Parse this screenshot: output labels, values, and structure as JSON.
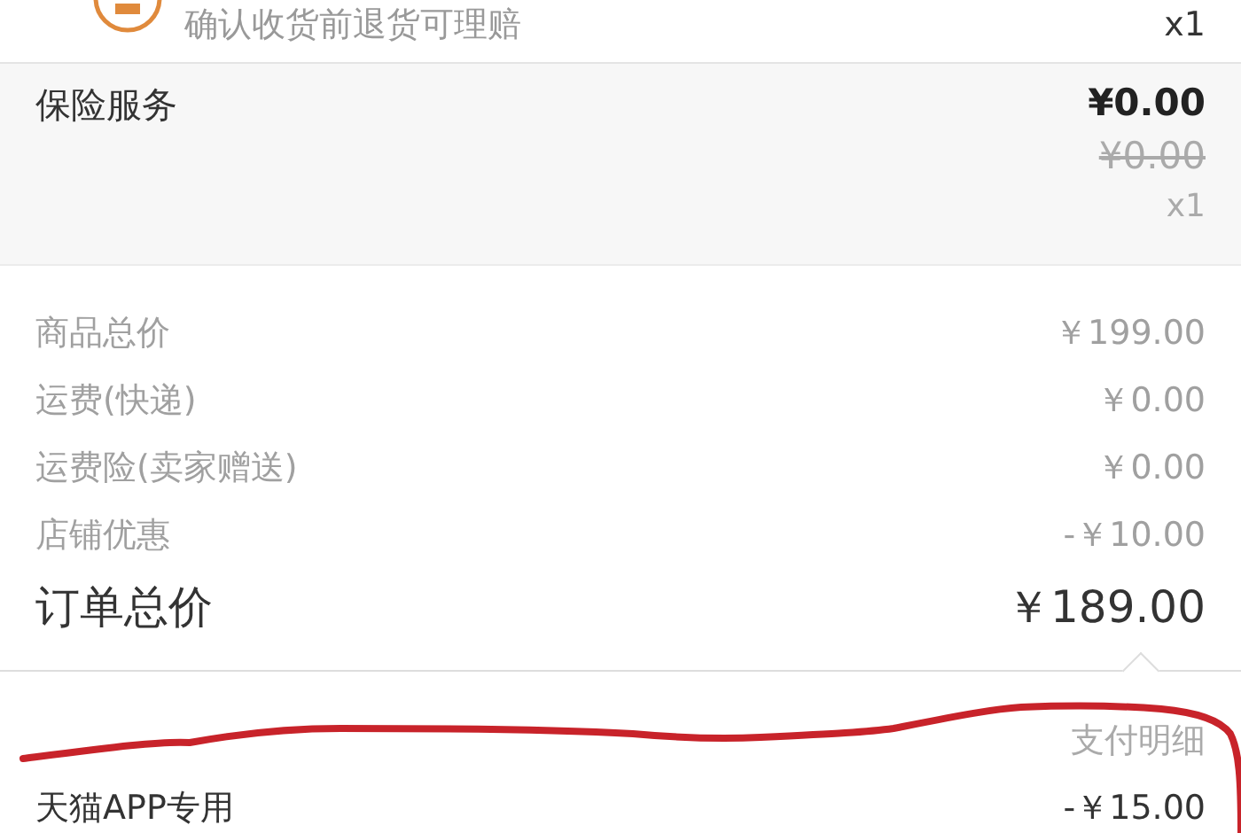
{
  "service_item": {
    "note": "确认收货前退货可理赔",
    "quantity": "x1"
  },
  "insurance": {
    "label": "保险服务",
    "price": "¥0.00",
    "original_price": "¥0.00",
    "quantity": "x1"
  },
  "summary": {
    "rows": [
      {
        "label": "商品总价",
        "value": "￥199.00"
      },
      {
        "label": "运费(快递)",
        "value": "￥0.00"
      },
      {
        "label": "运费险(卖家赠送)",
        "value": "￥0.00"
      },
      {
        "label": "店铺优惠",
        "value": "-￥10.00"
      }
    ],
    "total": {
      "label": "订单总价",
      "value": "￥189.00"
    }
  },
  "payment": {
    "header": "支付明细",
    "rows": [
      {
        "label": "天猫APP专用",
        "value": "-￥15.00"
      }
    ]
  }
}
